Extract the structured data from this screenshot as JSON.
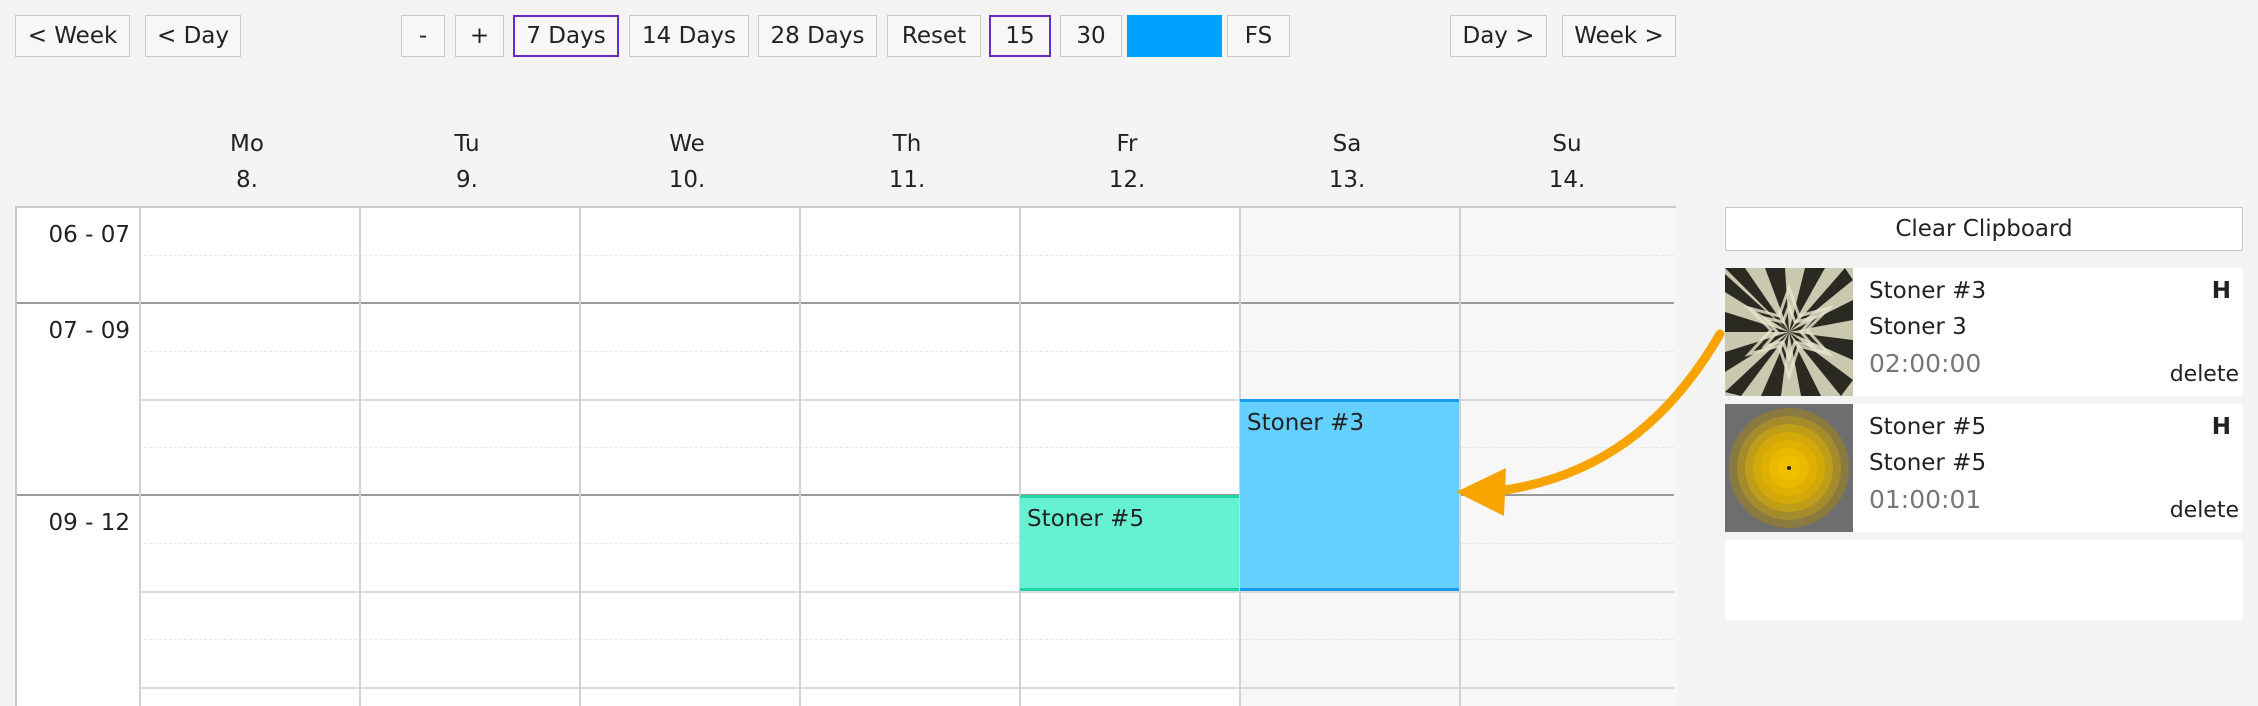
{
  "toolbar": {
    "prev_week": "< Week",
    "prev_day": "< Day",
    "zoom_out": "-",
    "zoom_in": "+",
    "days7": "7 Days",
    "days14": "14 Days",
    "days28": "28 Days",
    "reset": "Reset",
    "min15": "15",
    "min30": "30",
    "fs": "FS",
    "next_day": "Day >",
    "next_week": "Week >",
    "color_swatch": "#00a2ff"
  },
  "days": [
    {
      "name": "Mo",
      "date": "8."
    },
    {
      "name": "Tu",
      "date": "9."
    },
    {
      "name": "We",
      "date": "10."
    },
    {
      "name": "Th",
      "date": "11."
    },
    {
      "name": "Fr",
      "date": "12."
    },
    {
      "name": "Sa",
      "date": "13."
    },
    {
      "name": "Su",
      "date": "14."
    }
  ],
  "time_slots": [
    "06 - 07",
    "07 - 09",
    "09 - 12"
  ],
  "events": [
    {
      "title": "Stoner #5",
      "color": "#66f2d2"
    },
    {
      "title": "Stoner #3",
      "color": "#63d0ff"
    }
  ],
  "clipboard": {
    "clear_label": "Clear Clipboard",
    "items": [
      {
        "title": "Stoner #3",
        "subtitle": "Stoner 3",
        "duration": "02:00:00",
        "flag": "H",
        "delete": "delete",
        "thumb": "starburst-thumbnail"
      },
      {
        "title": "Stoner #5",
        "subtitle": "Stoner #5",
        "duration": "01:00:01",
        "flag": "H",
        "delete": "delete",
        "thumb": "concentric-circles-thumbnail"
      }
    ]
  },
  "colors": {
    "selected_border": "#6a2bc9",
    "arrow": "#f7a400",
    "weekend_bg": "#f7f7f7"
  }
}
